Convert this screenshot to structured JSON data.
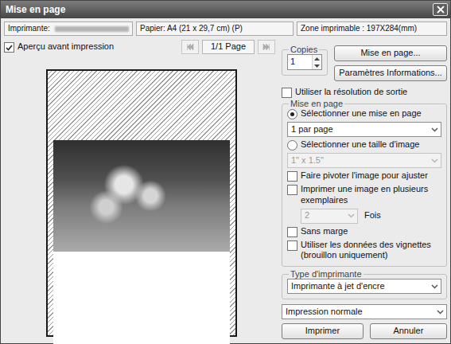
{
  "window": {
    "title": "Mise en page"
  },
  "info": {
    "printer_label": "Imprimante:",
    "paper": "Papier: A4 (21 x 29,7 cm) (P)",
    "printable_area": "Zone imprimable : 197X284(mm)"
  },
  "preview": {
    "label": "Aperçu avant impression",
    "checked": true,
    "page": "1/1 Page",
    "prev_disabled": true,
    "next_disabled": true
  },
  "copies": {
    "legend": "Copies",
    "value": "1"
  },
  "buttons": {
    "page_setup": "Mise en page...",
    "info_settings": "Paramètres Informations...",
    "print": "Imprimer",
    "cancel": "Annuler"
  },
  "output_resolution": {
    "label": "Utiliser la résolution de sortie",
    "checked": false
  },
  "layout": {
    "legend": "Mise en page",
    "modes": [
      {
        "label": "Sélectionner une mise en page",
        "selected": true,
        "value": "1 par page",
        "disabled": false
      },
      {
        "label": "Sélectionner une taille d'image",
        "selected": false,
        "value": "1\" x 1.5\"",
        "disabled": true
      }
    ],
    "options": [
      {
        "label": "Faire pivoter l'image pour ajuster",
        "checked": false
      },
      {
        "label": "Imprimer une image en plusieurs exemplaires",
        "checked": false,
        "count": {
          "value": "2",
          "unit": "Fois",
          "disabled": true
        }
      },
      {
        "label": "Sans marge",
        "checked": false
      },
      {
        "label": "Utiliser les données des vignettes (brouillon uniquement)",
        "checked": false
      }
    ]
  },
  "printer_type": {
    "legend": "Type d'imprimante",
    "value": "Imprimante à jet d'encre"
  },
  "quality": {
    "value": "Impression normale"
  }
}
